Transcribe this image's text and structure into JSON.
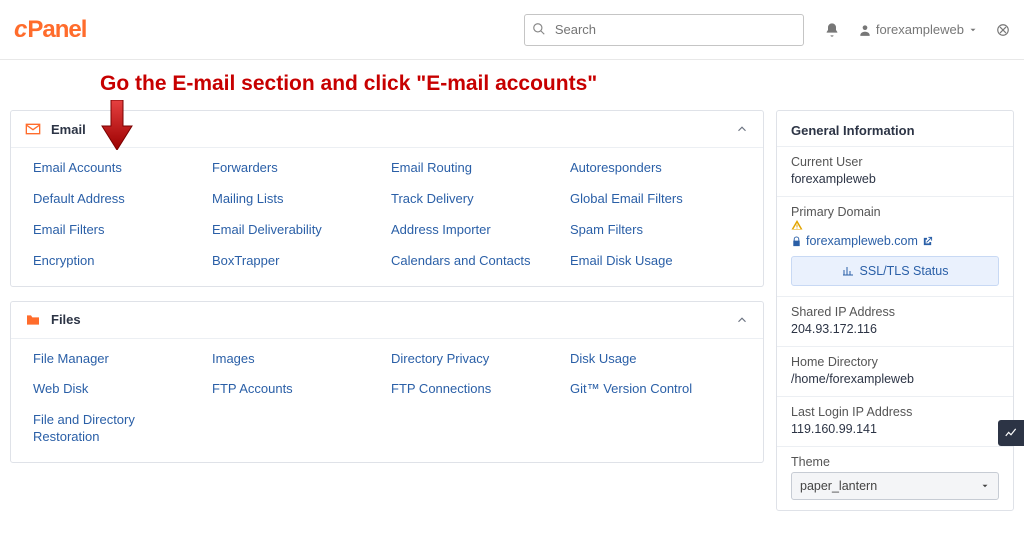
{
  "brand": {
    "c": "c",
    "panel": "Panel"
  },
  "search": {
    "placeholder": "Search"
  },
  "user": {
    "name": "forexampleweb"
  },
  "annotation": {
    "text": "Go the E-mail section and click \"E-mail accounts\""
  },
  "sections": {
    "email": {
      "title": "Email",
      "items": [
        "Email Accounts",
        "Forwarders",
        "Email Routing",
        "Autoresponders",
        "Default Address",
        "Mailing Lists",
        "Track Delivery",
        "Global Email Filters",
        "Email Filters",
        "Email Deliverability",
        "Address Importer",
        "Spam Filters",
        "Encryption",
        "BoxTrapper",
        "Calendars and Contacts",
        "Email Disk Usage"
      ]
    },
    "files": {
      "title": "Files",
      "items": [
        "File Manager",
        "Images",
        "Directory Privacy",
        "Disk Usage",
        "Web Disk",
        "FTP Accounts",
        "FTP Connections",
        "Git™ Version Control",
        "File and Directory Restoration"
      ]
    }
  },
  "info": {
    "title": "General Information",
    "current_user": {
      "label": "Current User",
      "value": "forexampleweb"
    },
    "primary_domain": {
      "label": "Primary Domain",
      "value": "forexampleweb.com"
    },
    "ssl_button": "SSL/TLS Status",
    "shared_ip": {
      "label": "Shared IP Address",
      "value": "204.93.172.116"
    },
    "home_dir": {
      "label": "Home Directory",
      "value": "/home/forexampleweb"
    },
    "last_login": {
      "label": "Last Login IP Address",
      "value": "119.160.99.141"
    },
    "theme": {
      "label": "Theme",
      "value": "paper_lantern"
    }
  }
}
